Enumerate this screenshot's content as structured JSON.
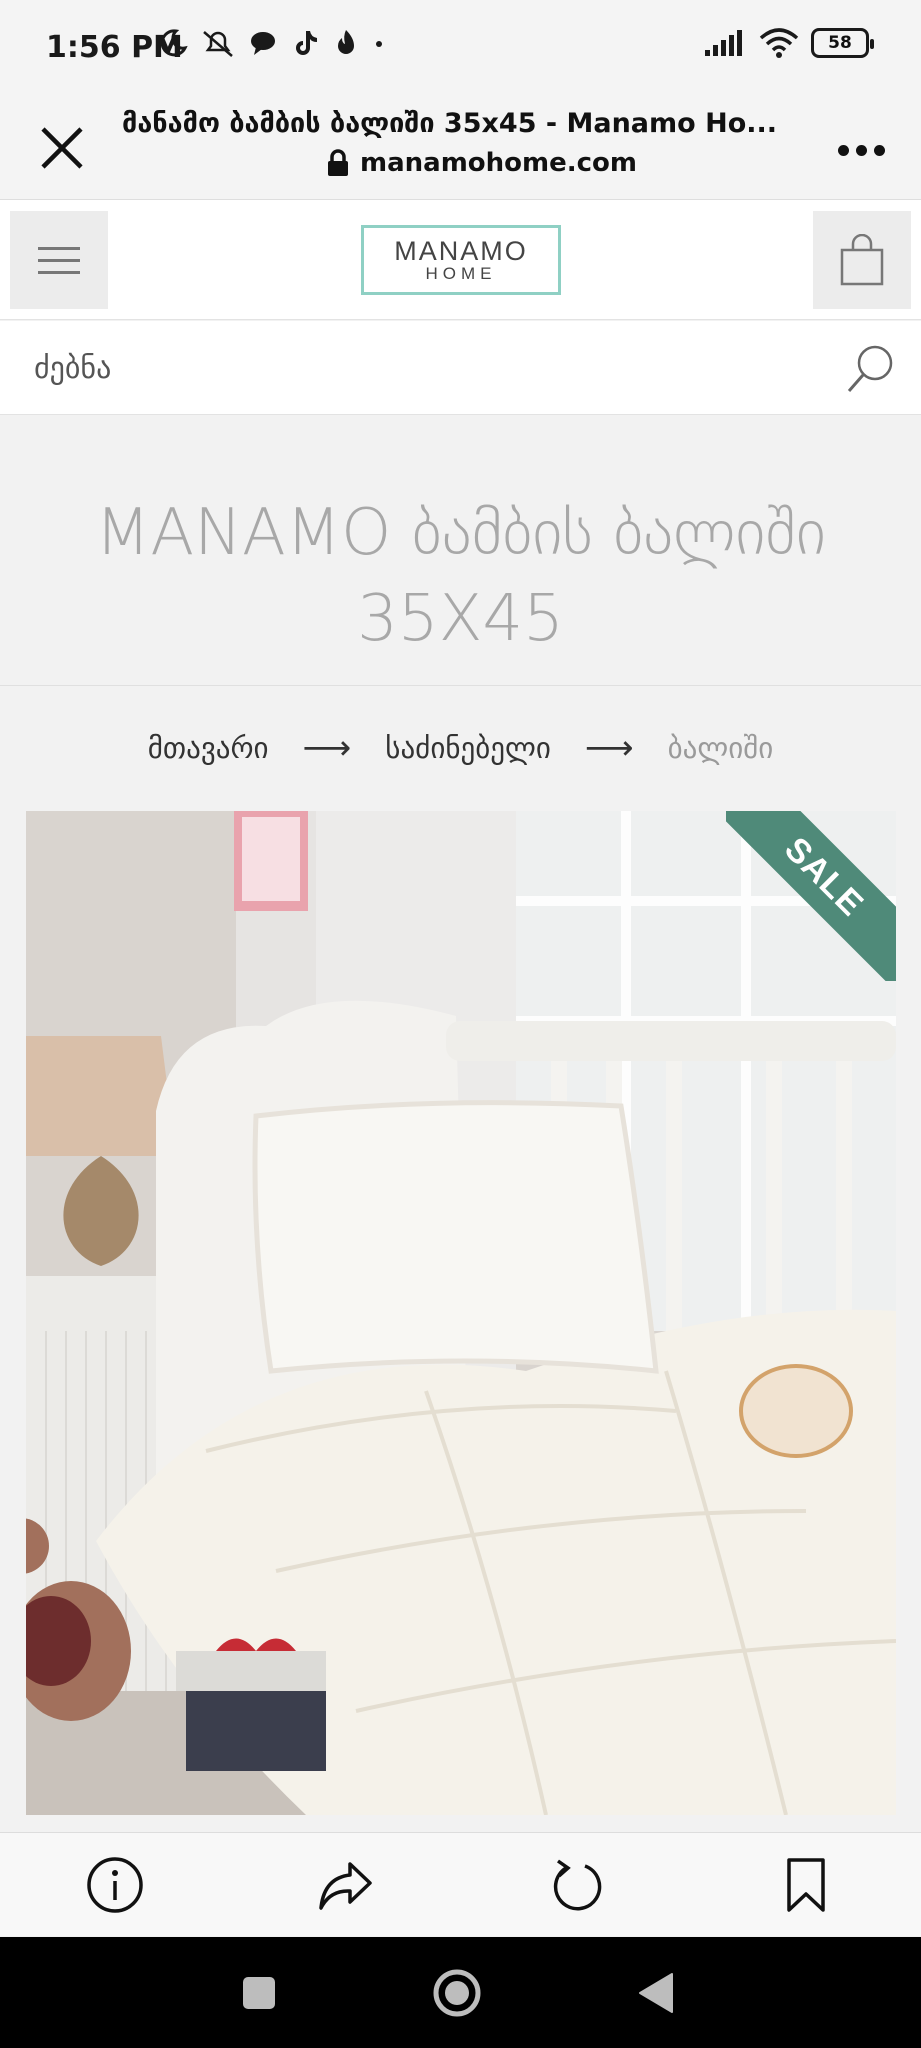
{
  "status_bar": {
    "time": "1:56 PM",
    "battery": "58",
    "left_icons": [
      "moon-icon",
      "mute-icon",
      "chat-icon",
      "tiktok-icon",
      "flame-icon",
      "dot-icon"
    ],
    "right_icons": [
      "signal-icon",
      "wifi-icon",
      "battery-icon"
    ]
  },
  "tab": {
    "title": "მანამო ბამბის ბალიში 35x45 - Manamo Ho...",
    "url": "manamohome.com"
  },
  "site": {
    "logo_main": "MANAMO",
    "logo_sub": "HOME"
  },
  "search": {
    "placeholder": "ძებნა"
  },
  "product": {
    "title": "MANAMO ბამბის ბალიში 35X45",
    "badge": "SALE"
  },
  "breadcrumb": {
    "items": [
      "მთავარი",
      "საძინებელი",
      "ბალიში"
    ],
    "separator": "⟶"
  },
  "colors": {
    "logo_border": "#8fd0c4",
    "sale_ribbon": "#4f8a79",
    "title_gray": "#a8a8a8"
  }
}
